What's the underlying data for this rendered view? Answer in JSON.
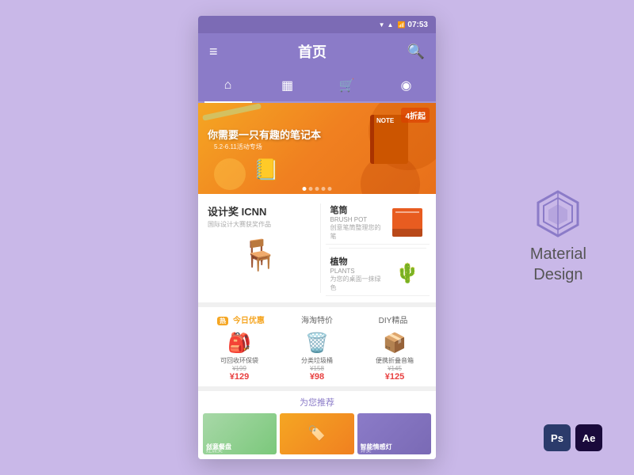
{
  "app": {
    "title": "首页",
    "time": "07:53"
  },
  "statusBar": {
    "time": "07:53",
    "icons": [
      "signal",
      "wifi",
      "battery"
    ]
  },
  "tabs": [
    {
      "id": "home",
      "icon": "⌂",
      "active": true
    },
    {
      "id": "grid",
      "icon": "▦",
      "active": false
    },
    {
      "id": "cart",
      "icon": "🛒",
      "active": false
    },
    {
      "id": "compass",
      "icon": "◎",
      "active": false
    }
  ],
  "banner": {
    "mainText": "你需要一只有趣的笔记本",
    "subText": "5.2-6.11活动专场",
    "discount": "4折起",
    "dots": [
      true,
      false,
      false,
      false,
      false
    ]
  },
  "categories": {
    "left": {
      "titleCn": "设计奖  ICNN",
      "desc": "国际设计大赛获奖作品",
      "image": "🪑"
    },
    "right": [
      {
        "cn": "笔筒",
        "en": "BRUSH POT",
        "desc": "创意笔筒整理您的笔",
        "image": "🖊️"
      },
      {
        "cn": "植物",
        "en": "PLANTS",
        "desc": "为您的桌面一抹绿色",
        "image": "🌵"
      }
    ]
  },
  "deals": {
    "tabs": [
      {
        "label": "今日优惠",
        "hot": true,
        "active": true
      },
      {
        "label": "海淘特价",
        "active": false
      },
      {
        "label": "DIY精品",
        "active": false
      }
    ],
    "items": [
      {
        "name": "可回收环保袋",
        "image": "🎒",
        "oldPrice": "¥199",
        "newPrice": "¥129"
      },
      {
        "name": "分类垃圾桶",
        "image": "🗑️",
        "oldPrice": "¥158",
        "newPrice": "¥98"
      },
      {
        "name": "便携折叠音箱",
        "image": "📦",
        "oldPrice": "¥145",
        "newPrice": "¥125"
      }
    ]
  },
  "recommend": {
    "title": "为您推荐",
    "items": [
      {
        "label": "创意餐盘",
        "sublabel": "红点奖",
        "color": "#a8d8a8"
      },
      {
        "label": "",
        "sublabel": "",
        "color": "#f5a623"
      },
      {
        "label": "智能情感灯",
        "sublabel": "评奖",
        "color": "#8b7bc8"
      }
    ]
  },
  "materialDesign": {
    "logoColor": "#8b7bc8",
    "text": "Material\nDesign"
  },
  "appIcons": [
    {
      "name": "Ps",
      "bg": "#2b3b6b"
    },
    {
      "name": "Ae",
      "bg": "#1a0a3b"
    }
  ]
}
